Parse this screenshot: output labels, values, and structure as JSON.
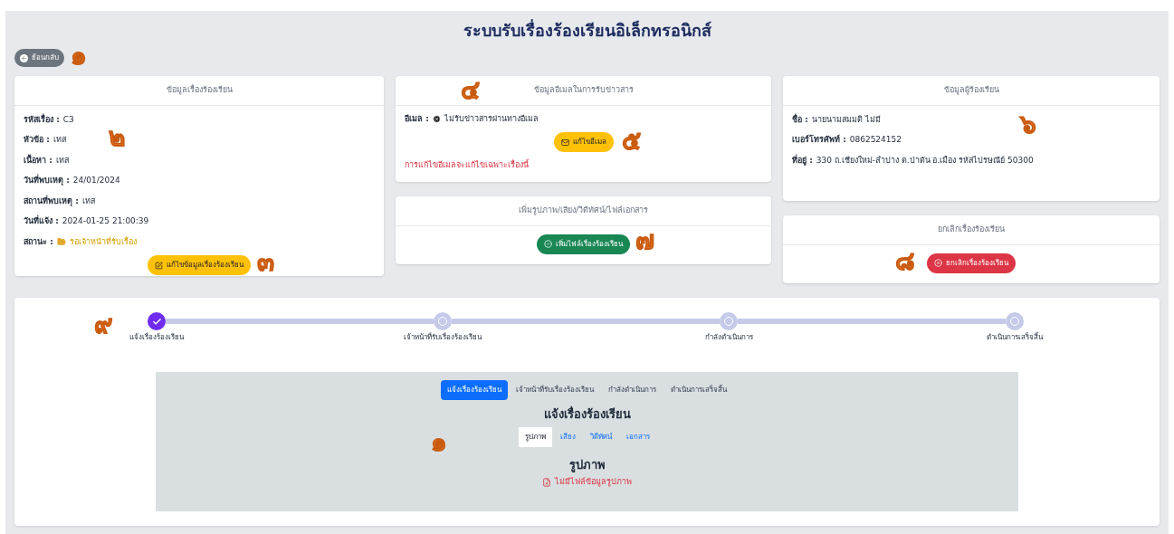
{
  "header": {
    "title": "ระบบรับเรื่องร้องเรียนอิเล็กทรอนิกส์"
  },
  "back_button": {
    "label": "ย้อนกลับ",
    "callout": "๑"
  },
  "complaint_card": {
    "title": "ข้อมูลเรื่องร้องเรียน",
    "callout": "๒",
    "fields": [
      {
        "kind": "text",
        "label": "รหัสเรื่อง :",
        "value": "C3"
      },
      {
        "kind": "text",
        "label": "หัวข้อ :",
        "value": "เทส"
      },
      {
        "kind": "text",
        "label": "เนื้อหา :",
        "value": "เทส"
      },
      {
        "kind": "text",
        "label": "วันที่พบเหตุ :",
        "value": "24/01/2024"
      },
      {
        "kind": "text",
        "label": "สถานที่พบเหตุ :",
        "value": "เทส"
      },
      {
        "kind": "text",
        "label": "วันที่แจ้ง :",
        "value": "2024-01-25 21:00:39"
      },
      {
        "kind": "status",
        "label": "สถานะ :",
        "value": "รอเจ้าหน้าที่รับเรื่อง"
      }
    ],
    "edit_button": {
      "label": "แก้ไขข้อมูลเรื่องร้องเรียน",
      "callout": "๓"
    }
  },
  "email_card": {
    "title": "ข้อมูลอีเมลในการรับข่าวสาร",
    "callout": "๔",
    "label": "อีเมล :",
    "value": "ไม่รับข่าวสารผ่านทางอีเมล",
    "edit_button": {
      "label": "แก้ไขอีเมล",
      "callout": "๕"
    },
    "note": "การแก้ไขอีเมลจะแก้ไขเฉพาะเรื่องนี้"
  },
  "files_card": {
    "title": "เพิ่มรูปภาพ/เสียง/วิดีทัศน์/ไฟล์เอกสาร",
    "add_button": {
      "label": "เพิ่มไฟล์เรื่องร้องเรียน",
      "callout": "๗"
    }
  },
  "complainant_card": {
    "title": "ข้อมูลผู้ร้องเรียน",
    "callout": "๖",
    "fields": [
      {
        "label": "ชื่อ :",
        "value": "นายนามสมมติ ไม่มี"
      },
      {
        "label": "เบอร์โทรศัพท์ :",
        "value": "0862524152"
      },
      {
        "label": "ที่อยู่ :",
        "value": "330 ถ.เชียงใหม่-ลำปาง ต.ป่าตัน อ.เมือง รหัสไปรษณีย์ 50300"
      }
    ]
  },
  "cancel_card": {
    "title": "ยกเลิกเรื่องร้องเรียน",
    "cancel_button": {
      "label": "ยกเลิกเรื่องร้องเรียน",
      "callout": "๘"
    }
  },
  "progress": {
    "callout": "๙",
    "steps": [
      {
        "label": "แจ้งเรื่องร้องเรียน",
        "done": true
      },
      {
        "label": "เจ้าหน้าที่รับเรื่องร้องเรียน",
        "done": false
      },
      {
        "label": "กำลังดำเนินการ",
        "done": false
      },
      {
        "label": "ดำเนินการเสร็จสิ้น",
        "done": false
      }
    ]
  },
  "files_panel": {
    "callout": "๑",
    "tabs": [
      {
        "label": "แจ้งเรื่องร้องเรียน",
        "selected": true
      },
      {
        "label": "เจ้าหน้าที่รับเรื่องร้องเรียน",
        "selected": false
      },
      {
        "label": "กำลังดำเนินการ",
        "selected": false
      },
      {
        "label": "ดำเนินการเสร็จสิ้น",
        "selected": false
      }
    ],
    "heading": "แจ้งเรื่องร้องเรียน",
    "subtabs": [
      {
        "label": "รูปภาพ",
        "selected": true
      },
      {
        "label": "เสียง",
        "selected": false
      },
      {
        "label": "วิดีทัศน์",
        "selected": false
      },
      {
        "label": "เอกสาร",
        "selected": false
      }
    ],
    "section_title": "รูปภาพ",
    "empty_message": "ไม่มีไฟล์ข้อมูลรูปภาพ"
  }
}
